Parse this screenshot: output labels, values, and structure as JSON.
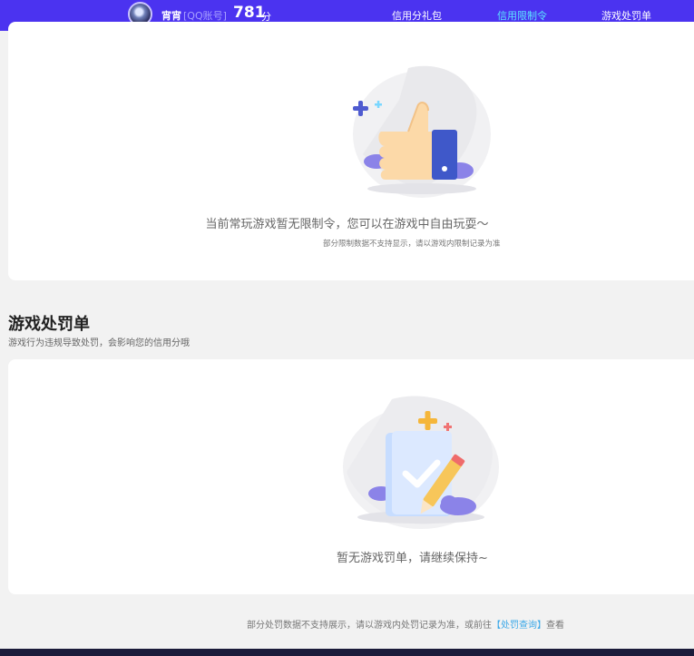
{
  "header": {
    "username": "宵宵",
    "account_type": "[QQ账号]",
    "score": "781",
    "score_unit": "分",
    "nav": {
      "gift": "信用分礼包",
      "restrict": "信用限制令",
      "punish": "游戏处罚单"
    }
  },
  "restrict_section": {
    "empty_title": "当前常玩游戏暂无限制令，您可以在游戏中自由玩耍～",
    "empty_sub": "部分限制数据不支持显示，请以游戏内限制记录为准"
  },
  "punish_section": {
    "title": "游戏处罚单",
    "subtitle": "游戏行为违规导致处罚，会影响您的信用分哦",
    "empty_title": "暂无游戏罚单，请继续保持~"
  },
  "footnote": {
    "prefix": "部分处罚数据不支持展示，请以游戏内处罚记录为准，或前往",
    "link": "【处罚查询】",
    "suffix": "查看"
  },
  "colors": {
    "header_bg": "#4b33f0",
    "active_nav": "#5ce6ff",
    "link": "#3ba8e8"
  }
}
